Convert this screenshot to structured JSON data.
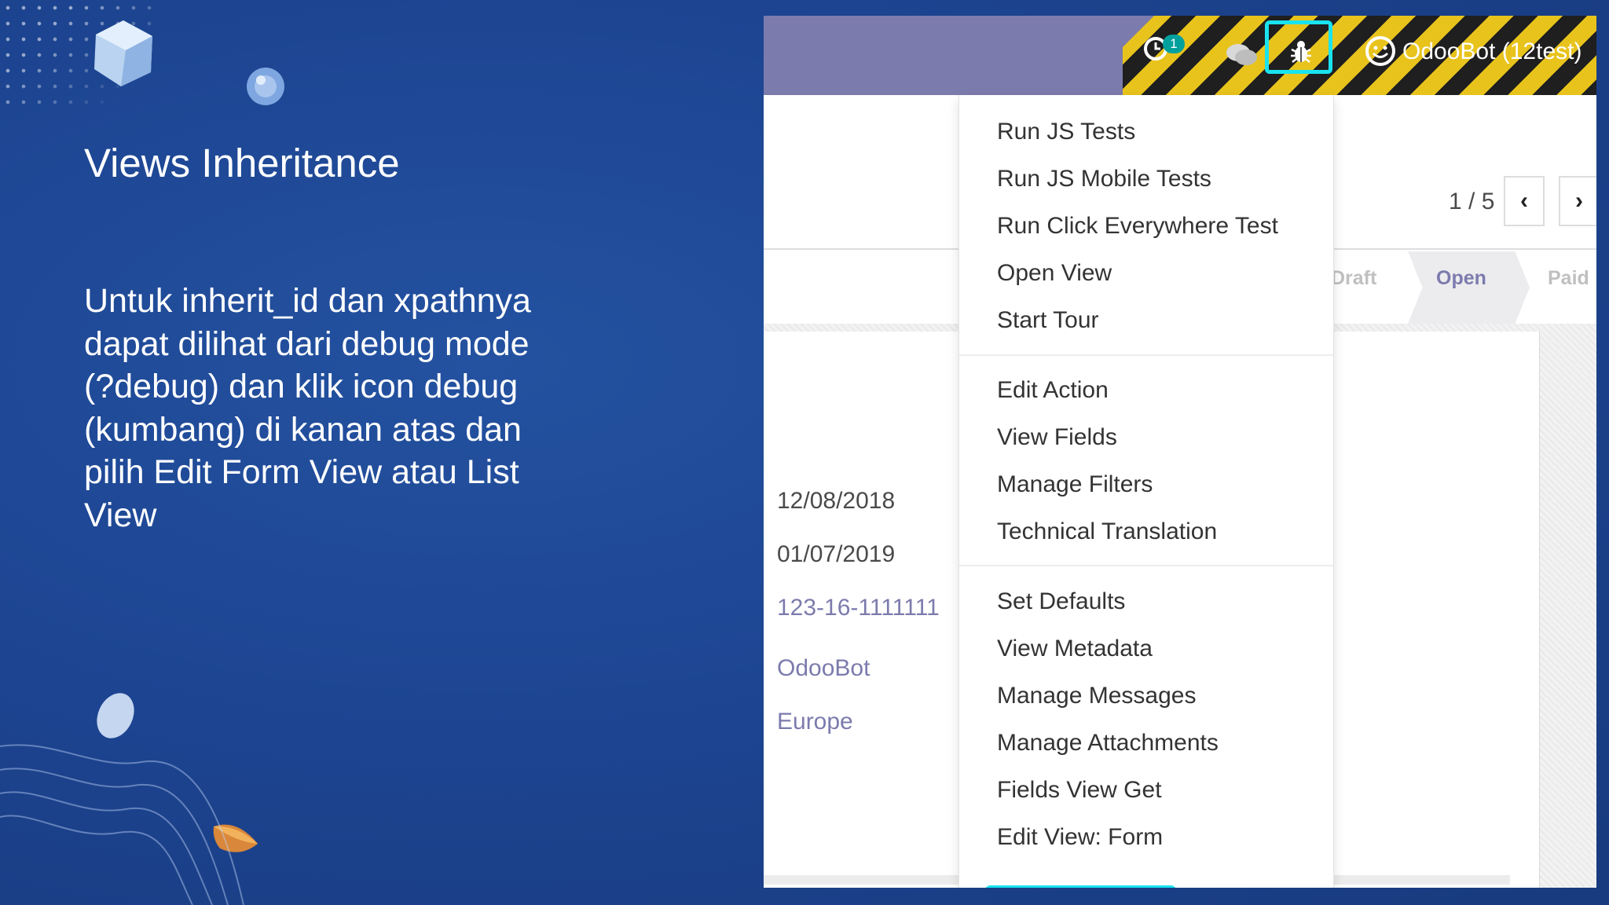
{
  "slide": {
    "title": "Views Inheritance",
    "body": "Untuk inherit_id dan xpathnya\ndapat dilihat dari debug mode\n(?debug) dan klik icon debug\n(kumbang) di kanan atas dan\npilih Edit Form View atau List\nView"
  },
  "navbar": {
    "activity_badge": "1",
    "user_label": "OdooBot (12test)"
  },
  "pager": {
    "value": "1 / 5",
    "prev": "‹",
    "next": "›"
  },
  "statusbar": {
    "stages": [
      "Draft",
      "Open",
      "Paid"
    ],
    "active": "Open"
  },
  "form_values": {
    "date_1": "12/08/2018",
    "date_2": "01/07/2019",
    "reference": "123-16-1111111",
    "salesperson": "OdooBot",
    "team": "Europe"
  },
  "debug_menu": {
    "group_1": [
      "Run JS Tests",
      "Run JS Mobile Tests",
      "Run Click Everywhere Test",
      "Open View",
      "Start Tour"
    ],
    "group_2": [
      "Edit Action",
      "View Fields",
      "Manage Filters",
      "Technical Translation"
    ],
    "group_3": [
      "Set Defaults",
      "View Metadata",
      "Manage Messages",
      "Manage Attachments",
      "Fields View Get",
      "Edit View: Form"
    ]
  },
  "colors": {
    "slide_bg": "#1d4592",
    "navbar": "#7c7bad",
    "highlight": "#19e3ef",
    "link": "#7c7bad"
  }
}
